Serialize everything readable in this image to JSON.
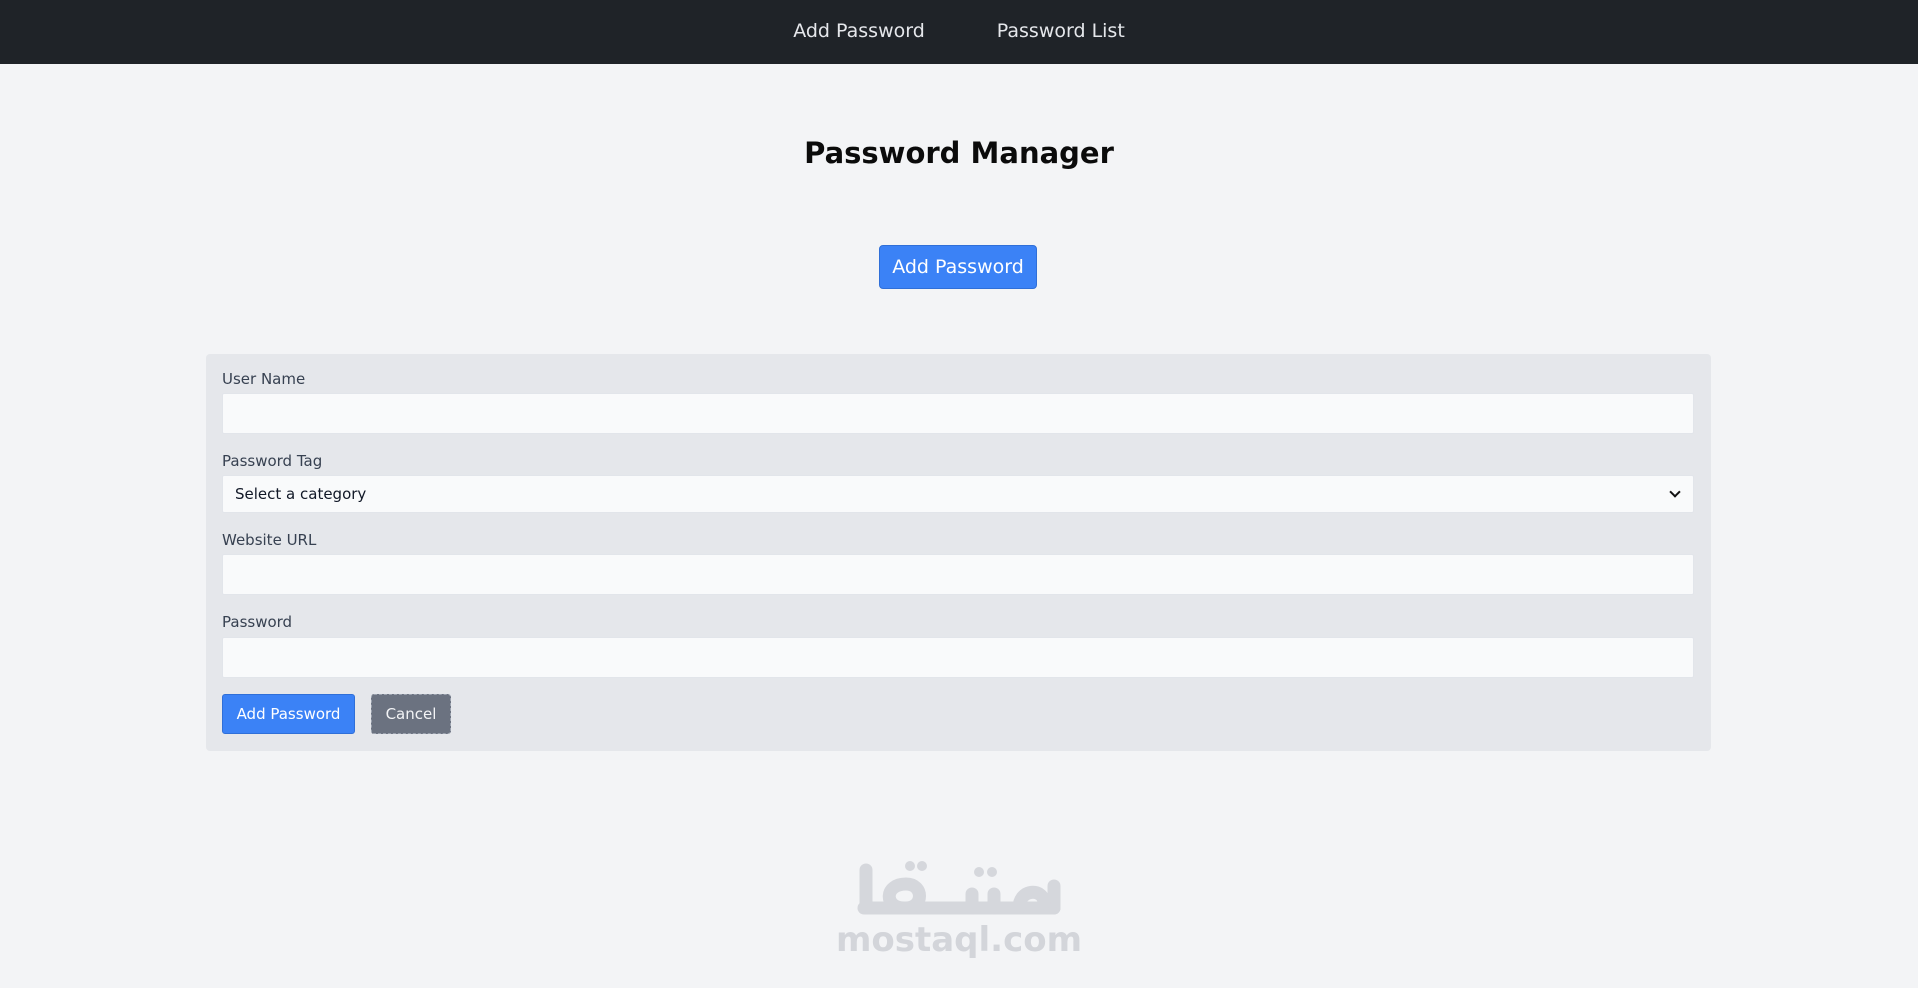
{
  "nav": {
    "items": [
      {
        "label": "Add Password"
      },
      {
        "label": "Password List"
      }
    ]
  },
  "page": {
    "title": "Password Manager",
    "open_form_button": "Add Password"
  },
  "form": {
    "username": {
      "label": "User Name",
      "value": ""
    },
    "tag": {
      "label": "Password Tag",
      "selected": "Select a category"
    },
    "website": {
      "label": "Website URL",
      "value": ""
    },
    "password": {
      "label": "Password",
      "value": ""
    },
    "submit_label": "Add Password",
    "cancel_label": "Cancel"
  },
  "watermark": {
    "logo_text": "مستقل",
    "text": "mostaql.com"
  },
  "colors": {
    "navbar": "#1f2328",
    "primary": "#3b82f6",
    "secondary": "#6b7280",
    "card": "#e5e7eb",
    "background": "#f3f4f6"
  }
}
